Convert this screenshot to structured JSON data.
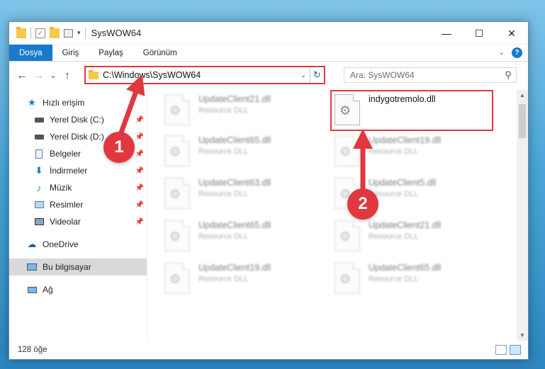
{
  "window": {
    "title": "SysWOW64",
    "controls": {
      "minimize": "—",
      "maximize": "☐",
      "close": "✕"
    }
  },
  "ribbon": {
    "tabs": [
      "Dosya",
      "Giriş",
      "Paylaş",
      "Görünüm"
    ],
    "help": "?"
  },
  "nav": {
    "back": "←",
    "forward": "→",
    "recent": "⌄",
    "up": "↑",
    "address": "C:\\Windows\\SysWOW64",
    "search_placeholder": "Ara: SysWOW64"
  },
  "sidebar": {
    "items": [
      {
        "label": "Hızlı erişim"
      },
      {
        "label": "Yerel Disk (C:)"
      },
      {
        "label": "Yerel Disk (D:)"
      },
      {
        "label": "Belgeler"
      },
      {
        "label": "İndirmeler"
      },
      {
        "label": "Müzik"
      },
      {
        "label": "Resimler"
      },
      {
        "label": "Videolar"
      },
      {
        "label": "OneDrive"
      },
      {
        "label": "Bu bilgisayar"
      },
      {
        "label": "Ağ"
      }
    ]
  },
  "files": [
    {
      "name": "UpdateClient21.dll",
      "type": "Resource DLL"
    },
    {
      "name": "indygotremolo.dll",
      "type": ""
    },
    {
      "name": "UpdateClient65.dll",
      "type": "Resource DLL"
    },
    {
      "name": "UpdateClient19.dll",
      "type": "Resource DLL"
    },
    {
      "name": "UpdateClient63.dll",
      "type": "Resource DLL"
    },
    {
      "name": "UpdateClient5.dll",
      "type": "Resource DLL"
    },
    {
      "name": "UpdateClient65.dll",
      "type": "Resource DLL"
    },
    {
      "name": "UpdateClient21.dll",
      "type": "Resource DLL"
    },
    {
      "name": "UpdateClient19.dll",
      "type": "Resource DLL"
    },
    {
      "name": "UpdateClient65.dll",
      "type": "Resource DLL"
    }
  ],
  "status": {
    "count": "128 öğe"
  },
  "annotations": {
    "step1": "1",
    "step2": "2"
  },
  "colors": {
    "accent": "#1979ca",
    "highlight": "#e0383e"
  }
}
